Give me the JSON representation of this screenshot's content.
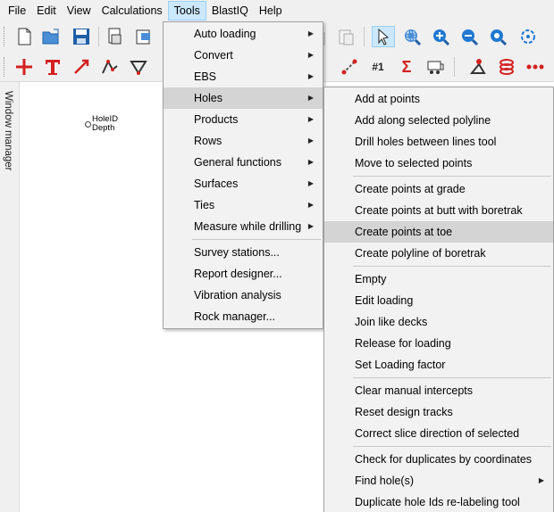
{
  "menubar": {
    "items": [
      "File",
      "Edit",
      "View",
      "Calculations",
      "Tools",
      "BlastIQ",
      "Help"
    ],
    "active": "Tools"
  },
  "side_panel": {
    "label": "Window manager"
  },
  "canvas": {
    "hole_label_line1": "HoleID",
    "hole_label_line2": "Depth"
  },
  "tools_menu": {
    "items": [
      {
        "label": "Auto loading",
        "submenu": true
      },
      {
        "label": "Convert",
        "submenu": true
      },
      {
        "label": "EBS",
        "submenu": true
      },
      {
        "label": "Holes",
        "submenu": true,
        "highlighted": true
      },
      {
        "label": "Products",
        "submenu": true
      },
      {
        "label": "Rows",
        "submenu": true
      },
      {
        "label": "General functions",
        "submenu": true
      },
      {
        "label": "Surfaces",
        "submenu": true
      },
      {
        "label": "Ties",
        "submenu": true
      },
      {
        "label": "Measure while drilling",
        "submenu": true
      },
      {
        "separator": true
      },
      {
        "label": "Survey stations..."
      },
      {
        "label": "Report designer..."
      },
      {
        "label": "Vibration analysis"
      },
      {
        "label": "Rock manager..."
      }
    ]
  },
  "holes_menu": {
    "items": [
      {
        "label": "Add at points"
      },
      {
        "label": "Add along selected polyline"
      },
      {
        "label": "Drill holes between lines tool"
      },
      {
        "label": "Move to selected points"
      },
      {
        "separator": true
      },
      {
        "label": "Create points at grade"
      },
      {
        "label": "Create points at butt with boretrak"
      },
      {
        "label": "Create points at toe",
        "highlighted": true
      },
      {
        "label": "Create polyline of boretrak"
      },
      {
        "separator": true
      },
      {
        "label": "Empty"
      },
      {
        "label": "Edit loading"
      },
      {
        "label": "Join like decks"
      },
      {
        "label": "Release for loading"
      },
      {
        "label": "Set Loading factor"
      },
      {
        "separator": true
      },
      {
        "label": "Clear manual intercepts"
      },
      {
        "label": "Reset design tracks"
      },
      {
        "label": "Correct slice direction of selected"
      },
      {
        "separator": true
      },
      {
        "label": "Check for duplicates by coordinates"
      },
      {
        "label": "Find hole(s)",
        "submenu": true
      },
      {
        "label": "Duplicate hole Ids re-labeling tool"
      }
    ]
  },
  "toolbar1": {
    "icons": [
      "new-file-icon",
      "open-folder-icon",
      "save-icon",
      "print-preview-icon",
      "export-icon",
      "copy-icon",
      "paste-icon",
      "select-arrow-icon",
      "zoom-window-icon",
      "zoom-in-icon",
      "zoom-out-icon",
      "zoom-extents-icon",
      "rotate-icon"
    ]
  },
  "toolbar2": {
    "icons": [
      "add-point-icon",
      "text-tool-icon",
      "line-arrow-icon",
      "polyline-icon",
      "triangle-icon",
      "point-move-icon",
      "hole-number-icon",
      "sum-report-icon",
      "truck-icon",
      "marker-icon",
      "spring-icon",
      "dots-icon"
    ],
    "hole_number_text": "#1",
    "sum_text": "Σ"
  },
  "colors": {
    "menu_bg": "#f2f2f2",
    "highlight": "#d4d4d4",
    "active_menubar": "#cce8ff",
    "toolbar_red": "#d42020",
    "toolbar_blue": "#1f78d1"
  }
}
